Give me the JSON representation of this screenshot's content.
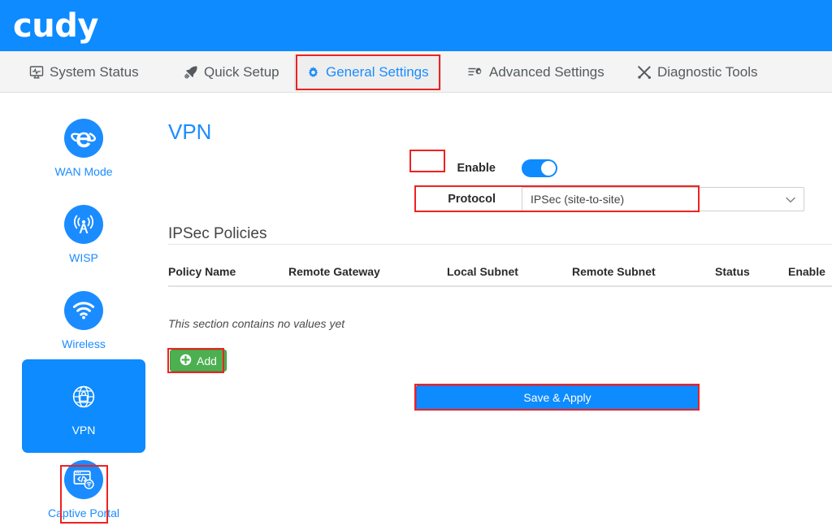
{
  "header": {
    "logo_text": "cudy",
    "brand_color": "#0d8bff"
  },
  "nav": {
    "tabs": [
      {
        "label": "System Status",
        "icon": "monitor-pulse-icon",
        "active": false
      },
      {
        "label": "Quick Setup",
        "icon": "rocket-icon",
        "active": false
      },
      {
        "label": "General Settings",
        "icon": "gear-icon",
        "active": true
      },
      {
        "label": "Advanced Settings",
        "icon": "sliders-gear-icon",
        "active": false
      },
      {
        "label": "Diagnostic Tools",
        "icon": "tools-icon",
        "active": false
      }
    ]
  },
  "sidebar": {
    "items": [
      {
        "label": "WAN Mode",
        "icon": "internet-explorer-e-icon",
        "active": false
      },
      {
        "label": "WISP",
        "icon": "broadcast-tower-icon",
        "active": false
      },
      {
        "label": "Wireless",
        "icon": "wifi-icon",
        "active": false
      },
      {
        "label": "VPN",
        "icon": "globe-lock-icon",
        "active": true
      },
      {
        "label": "Captive Portal",
        "icon": "browser-code-wifi-icon",
        "active": false
      }
    ]
  },
  "main": {
    "page_title": "VPN",
    "enable": {
      "label": "Enable",
      "state": "on"
    },
    "protocol": {
      "label": "Protocol",
      "value": "IPSec (site-to-site)",
      "icon": "chevron-down-icon"
    },
    "policies": {
      "section_title": "IPSec Policies",
      "columns": [
        "Policy Name",
        "Remote Gateway",
        "Local Subnet",
        "Remote Subnet",
        "Status",
        "Enable"
      ],
      "rows": [],
      "empty_message": "This section contains no values yet"
    },
    "add_button": {
      "label": "Add",
      "icon": "plus-circle-icon",
      "color": "#4cb050"
    },
    "save_button": {
      "label": "Save & Apply",
      "color": "#0d8bff"
    }
  },
  "annotations": {
    "highlight_color": "#ee2222",
    "boxes": [
      "general-settings-tab",
      "vpn-sidebar-item",
      "enable-toggle",
      "protocol-select",
      "add-button",
      "save-apply-button"
    ]
  }
}
